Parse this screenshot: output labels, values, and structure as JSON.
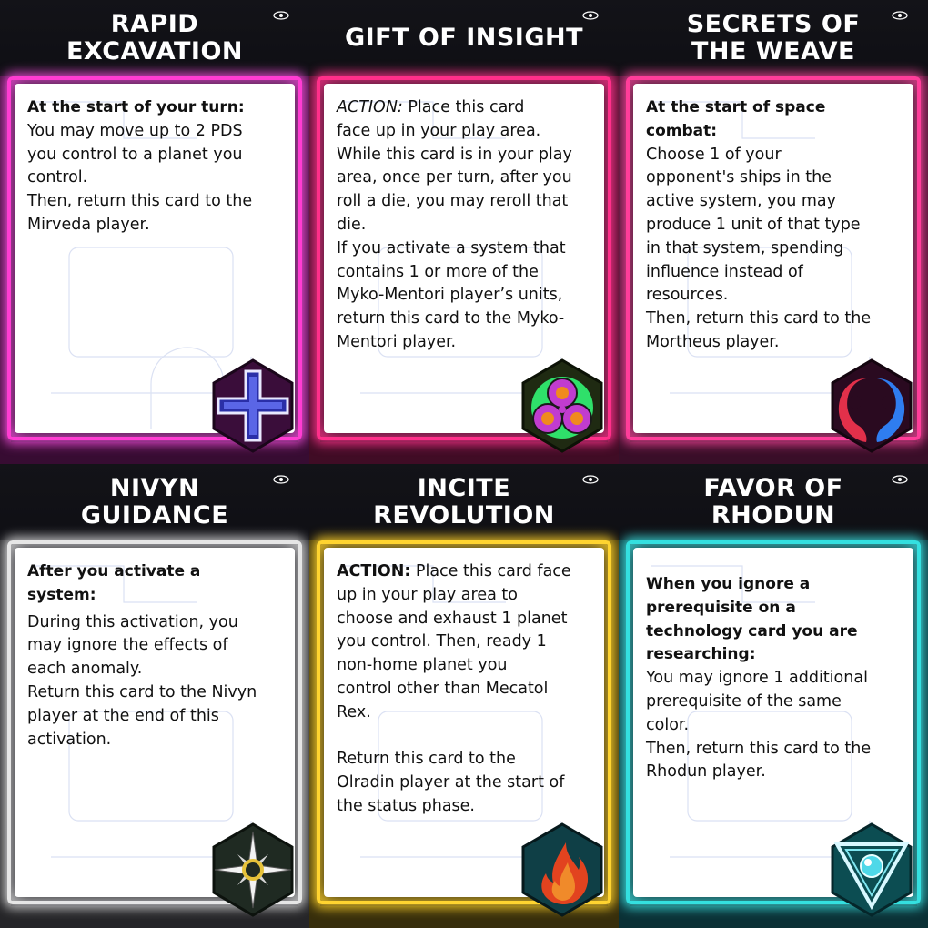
{
  "cards": [
    {
      "title": "RAPID\nEXCAVATION",
      "lead": "At the start of your turn:",
      "body": "You may move up to 2 PDS\nyou control to a planet you\ncontrol.\nThen, return this card to the\nMirveda player.",
      "accent": "#ff3cd2",
      "faction_icon": "mirveda-cross-icon"
    },
    {
      "title": "GIFT OF INSIGHT",
      "action": "ACTION:",
      "body": " Place this card\nface up in your play area.\nWhile this card is in your play\narea, once per turn, after you\nroll a die, you may reroll that\ndie.\nIf you activate a system that\ncontains 1 or more of the\nMyko-Mentori player’s units,\nreturn this card to the Myko-\nMentori player.",
      "accent": "#ff2f8a",
      "faction_icon": "myko-mentori-spores-icon"
    },
    {
      "title": "SECRETS OF\nTHE WEAVE",
      "lead": "At the start of space\ncombat:",
      "body": "Choose 1 of your\nopponent's ships in the\nactive system, you may\nproduce 1 unit of that type\nin that system, spending\ninfluence instead of\nresources.\nThen, return this card to the\nMortheus player.",
      "accent": "#ff3d9a",
      "faction_icon": "mortheus-yin-yang-icon"
    },
    {
      "title": "NIVYN\nGUIDANCE",
      "lead": "After you activate a\nsystem:",
      "body": "During this activation, you\nmay ignore the effects of\neach anomaly.\nReturn this card to the Nivyn\nplayer at the end of this\nactivation.",
      "accent": "#e6e6e6",
      "faction_icon": "nivyn-star-icon"
    },
    {
      "title": "INCITE\nREVOLUTION",
      "action": "ACTION:",
      "body": "  Place this card face\nup in your play area to\nchoose and exhaust 1 planet\nyou control. Then, ready 1\nnon-home planet you\ncontrol other than Mecatol\nRex.\n\nReturn this card to the\nOlradin player at the start of\nthe status phase.",
      "accent": "#ffd430",
      "faction_icon": "olradin-flame-icon"
    },
    {
      "title": "FAVOR OF RHODUN",
      "lead": "When you ignore a\nprerequisite on a\ntechnology card you are\nresearching:",
      "body": "You may ignore 1 additional\nprerequisite of the same\ncolor.\nThen, return this card to the\nRhodun player.",
      "accent": "#34e0e0",
      "faction_icon": "rhodun-triangle-icon"
    }
  ]
}
